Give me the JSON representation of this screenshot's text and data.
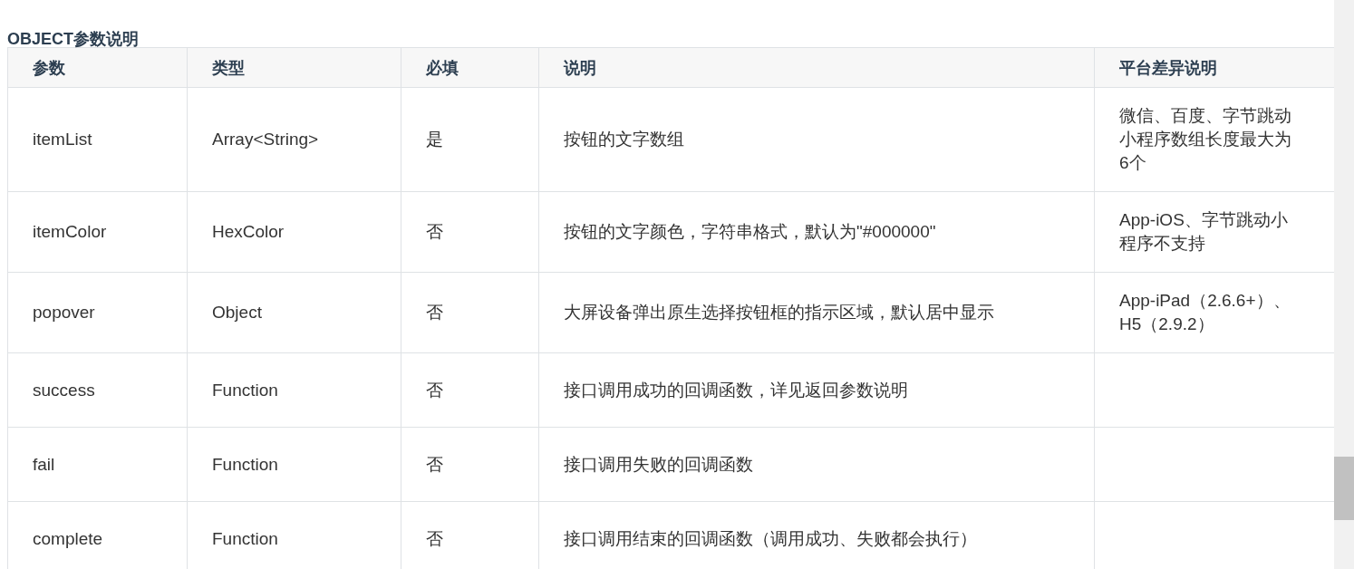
{
  "heading": "OBJECT参数说明",
  "table": {
    "columns": [
      "参数",
      "类型",
      "必填",
      "说明",
      "平台差异说明"
    ],
    "rows": [
      {
        "cells": [
          "itemList",
          "Array<String>",
          "是",
          "按钮的文字数组",
          "微信、百度、字节跳动小程序数组长度最大为6个"
        ]
      },
      {
        "cells": [
          "itemColor",
          "HexColor",
          "否",
          "按钮的文字颜色，字符串格式，默认为\"#000000\"",
          "App-iOS、字节跳动小程序不支持"
        ]
      },
      {
        "cells": [
          "popover",
          "Object",
          "否",
          "大屏设备弹出原生选择按钮框的指示区域，默认居中显示",
          "App-iPad（2.6.6+）、H5（2.9.2）"
        ]
      },
      {
        "cells": [
          "success",
          "Function",
          "否",
          "接口调用成功的回调函数，详见返回参数说明",
          ""
        ]
      },
      {
        "cells": [
          "fail",
          "Function",
          "否",
          "接口调用失败的回调函数",
          ""
        ]
      },
      {
        "cells": [
          "complete",
          "Function",
          "否",
          "接口调用结束的回调函数（调用成功、失败都会执行）",
          ""
        ]
      }
    ]
  }
}
